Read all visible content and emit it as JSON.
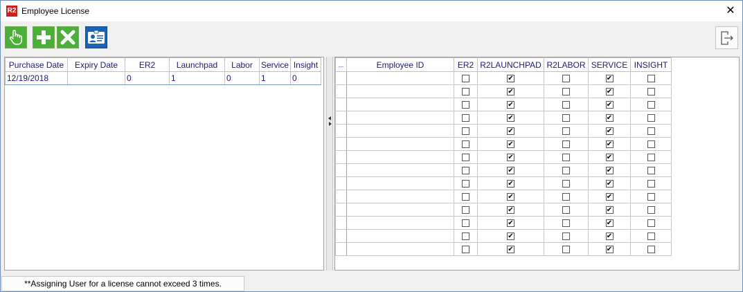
{
  "window": {
    "app_icon": "R2",
    "title": "Employee License",
    "close_glyph": "✕"
  },
  "toolbar": {
    "buttons": [
      {
        "name": "select-button",
        "icon": "hand-pointer-icon",
        "color": "#4caf3a"
      },
      {
        "name": "add-button",
        "icon": "plus-icon",
        "color": "#4caf3a"
      },
      {
        "name": "delete-button",
        "icon": "x-icon",
        "color": "#4caf3a"
      },
      {
        "name": "employee-card-button",
        "icon": "id-card-icon",
        "color": "#1a62b4"
      }
    ],
    "exit_icon": "exit-icon"
  },
  "license_table": {
    "headers": [
      "Purchase Date",
      "Expiry Date",
      "ER2",
      "Launchpad",
      "Labor",
      "Service",
      "Insight"
    ],
    "rows": [
      [
        "12/19/2018",
        "",
        "0",
        "1",
        "0",
        "1",
        "0"
      ]
    ]
  },
  "assignment_table": {
    "headers": [
      "...",
      "Employee ID",
      "ER2",
      "R2LAUNCHPAD",
      "R2LABOR",
      "SERVICE",
      "INSIGHT"
    ],
    "check_glyph": "✔",
    "rows": [
      {
        "employee_id": "",
        "er2": false,
        "launchpad": true,
        "labor": false,
        "service": true,
        "insight": false
      },
      {
        "employee_id": "",
        "er2": false,
        "launchpad": true,
        "labor": false,
        "service": true,
        "insight": false
      },
      {
        "employee_id": "",
        "er2": false,
        "launchpad": true,
        "labor": false,
        "service": true,
        "insight": false
      },
      {
        "employee_id": "",
        "er2": false,
        "launchpad": true,
        "labor": false,
        "service": true,
        "insight": false
      },
      {
        "employee_id": "",
        "er2": false,
        "launchpad": true,
        "labor": false,
        "service": true,
        "insight": false
      },
      {
        "employee_id": "",
        "er2": false,
        "launchpad": true,
        "labor": false,
        "service": true,
        "insight": false
      },
      {
        "employee_id": "",
        "er2": false,
        "launchpad": true,
        "labor": false,
        "service": true,
        "insight": false
      },
      {
        "employee_id": "",
        "er2": false,
        "launchpad": true,
        "labor": false,
        "service": true,
        "insight": false
      },
      {
        "employee_id": "",
        "er2": false,
        "launchpad": true,
        "labor": false,
        "service": true,
        "insight": false
      },
      {
        "employee_id": "",
        "er2": false,
        "launchpad": true,
        "labor": false,
        "service": true,
        "insight": false
      },
      {
        "employee_id": "",
        "er2": false,
        "launchpad": true,
        "labor": false,
        "service": true,
        "insight": false
      },
      {
        "employee_id": "",
        "er2": false,
        "launchpad": true,
        "labor": false,
        "service": true,
        "insight": false
      },
      {
        "employee_id": "",
        "er2": false,
        "launchpad": true,
        "labor": false,
        "service": true,
        "insight": false
      },
      {
        "employee_id": "",
        "er2": false,
        "launchpad": true,
        "labor": false,
        "service": true,
        "insight": false
      }
    ]
  },
  "status_bar": {
    "message": "**Assigning User for a license cannot exceed 3 times."
  }
}
